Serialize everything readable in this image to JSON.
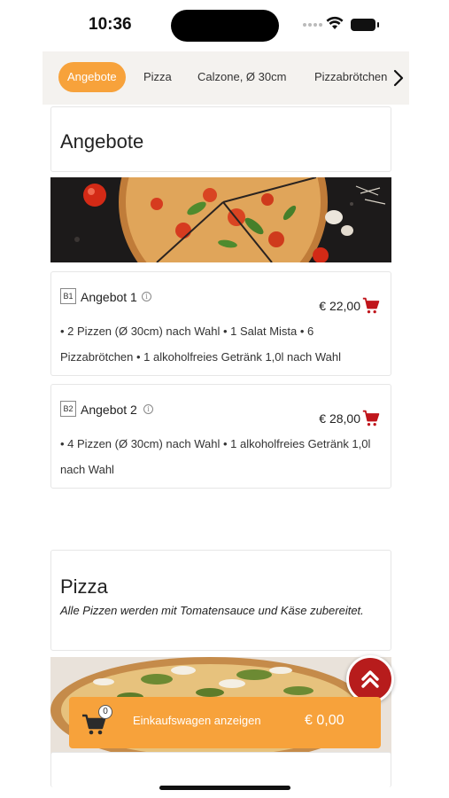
{
  "status_bar": {
    "time": "10:36"
  },
  "tabs": [
    {
      "label": "Angebote",
      "active": true
    },
    {
      "label": "Pizza",
      "active": false
    },
    {
      "label": "Calzone, Ø 30cm",
      "active": false
    },
    {
      "label": "Pizzabrötchen",
      "active": false
    }
  ],
  "sections": {
    "angebote": {
      "title": "Angebote",
      "items": [
        {
          "badge": "B1",
          "name": "Angebot 1",
          "price": "€ 22,00",
          "description": "• 2 Pizzen (Ø 30cm) nach Wahl • 1 Salat Mista • 6 Pizzabrötchen • 1 alkoholfreies Getränk 1,0l nach Wahl"
        },
        {
          "badge": "B2",
          "name": "Angebot 2",
          "price": "€ 28,00",
          "description": "• 4 Pizzen (Ø 30cm) nach Wahl • 1 alkoholfreies Getränk 1,0l nach Wahl"
        }
      ]
    },
    "pizza": {
      "title": "Pizza",
      "description": "Alle Pizzen werden mit Tomatensauce und Käse zubereitet."
    }
  },
  "cart": {
    "count": "0",
    "label": "Einkaufswagen anzeigen",
    "total": "€ 0,00"
  },
  "colors": {
    "accent": "#f7a23b",
    "cart_red": "#b71c1c",
    "tab_bar_bg": "#f4f2ef"
  }
}
